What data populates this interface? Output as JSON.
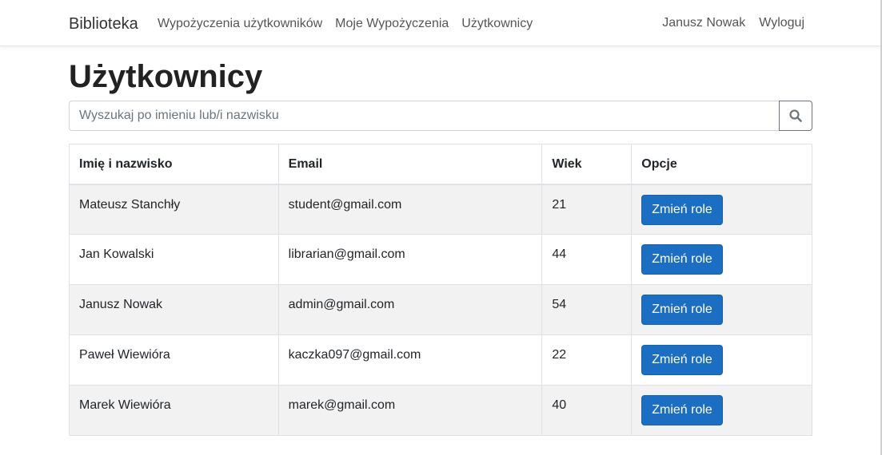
{
  "navbar": {
    "brand": "Biblioteka",
    "left_links": [
      {
        "label": "Wypożyczenia użytkowników"
      },
      {
        "label": "Moje Wypożyczenia"
      },
      {
        "label": "Użytkownicy"
      }
    ],
    "user_name": "Janusz Nowak",
    "logout_label": "Wyloguj"
  },
  "page": {
    "title": "Użytkownicy"
  },
  "search": {
    "placeholder": "Wyszukaj po imieniu lub/i nazwisku",
    "value": "",
    "button_icon": "search-icon"
  },
  "table": {
    "headers": [
      "Imię i nazwisko",
      "Email",
      "Wiek",
      "Opcje"
    ],
    "rows": [
      {
        "name": "Mateusz Stanchły",
        "email": "student@gmail.com",
        "age": "21",
        "action": "Zmień role"
      },
      {
        "name": "Jan Kowalski",
        "email": "librarian@gmail.com",
        "age": "44",
        "action": "Zmień role"
      },
      {
        "name": "Janusz Nowak",
        "email": "admin@gmail.com",
        "age": "54",
        "action": "Zmień role"
      },
      {
        "name": "Paweł Wiewióra",
        "email": "kaczka097@gmail.com",
        "age": "22",
        "action": "Zmień role"
      },
      {
        "name": "Marek Wiewióra",
        "email": "marek@gmail.com",
        "age": "40",
        "action": "Zmień role"
      }
    ]
  },
  "colors": {
    "primary_button": "#1b6ec2",
    "striped_row": "#f2f2f2",
    "border": "#dee2e6"
  }
}
